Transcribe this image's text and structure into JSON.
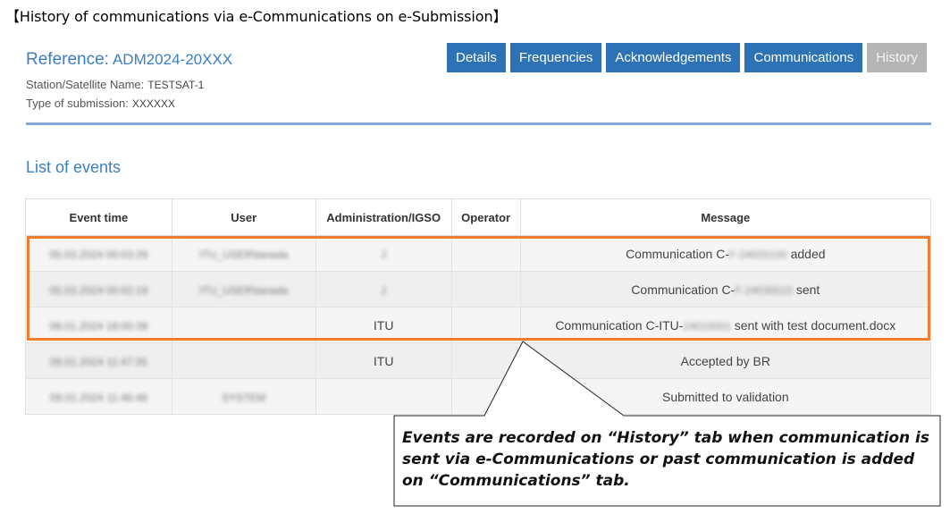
{
  "document": {
    "title": "【History of communications via e-Communications on e-Submission】"
  },
  "header": {
    "reference_label": "Reference:",
    "reference_value": "ADM2024-20XXX",
    "station_label": "Station/Satellite Name:",
    "station_value": "TESTSAT-1",
    "submission_type_label": "Type of submission:",
    "submission_type_value": "XXXXXX"
  },
  "tabs": [
    {
      "label": "Details",
      "state": "enabled"
    },
    {
      "label": "Frequencies",
      "state": "enabled"
    },
    {
      "label": "Acknowledgements",
      "state": "enabled"
    },
    {
      "label": "Communications",
      "state": "enabled"
    },
    {
      "label": "History",
      "state": "active-disabled"
    }
  ],
  "events": {
    "title": "List of events",
    "columns": [
      "Event time",
      "User",
      "Administration/IGSO",
      "Operator",
      "Message"
    ],
    "rows": [
      {
        "event_time": "05.03.2024 00:03:29",
        "user": "ITU_USER\\tanada",
        "administration": "J",
        "operator": "",
        "message_prefix": "Communication C-",
        "message_hidden": "F-24020100",
        "message_suffix": " added"
      },
      {
        "event_time": "05.03.2024 00:02:19",
        "user": "ITU_USER\\tanada",
        "administration": "J",
        "operator": "",
        "message_prefix": "Communication C-",
        "message_hidden": "F-24030015",
        "message_suffix": " sent"
      },
      {
        "event_time": "09.01.2024 18:00:39",
        "user": "",
        "administration": "ITU",
        "operator": "",
        "message_prefix": "Communication C-ITU-",
        "message_hidden": "24010001",
        "message_suffix": " sent with test document.docx"
      },
      {
        "event_time": "09.01.2024 11:47:35",
        "user": "",
        "administration": "ITU",
        "operator": "",
        "message_prefix": "Accepted by BR",
        "message_hidden": "",
        "message_suffix": ""
      },
      {
        "event_time": "09.01.2024 11:46:46",
        "user": "SYSTEM",
        "administration": "",
        "operator": "",
        "message_prefix": "Submitted to validation",
        "message_hidden": "",
        "message_suffix": ""
      }
    ]
  },
  "callout": {
    "text": "Events are recorded on “History” tab when communication is sent via e-Communications or past communication is added on “Communications” tab."
  },
  "colors": {
    "tab_blue": "#2d72b5",
    "tab_disabled": "#b5b5b5",
    "link_blue": "#3a7ec4",
    "highlight_orange": "#ed7d31"
  }
}
